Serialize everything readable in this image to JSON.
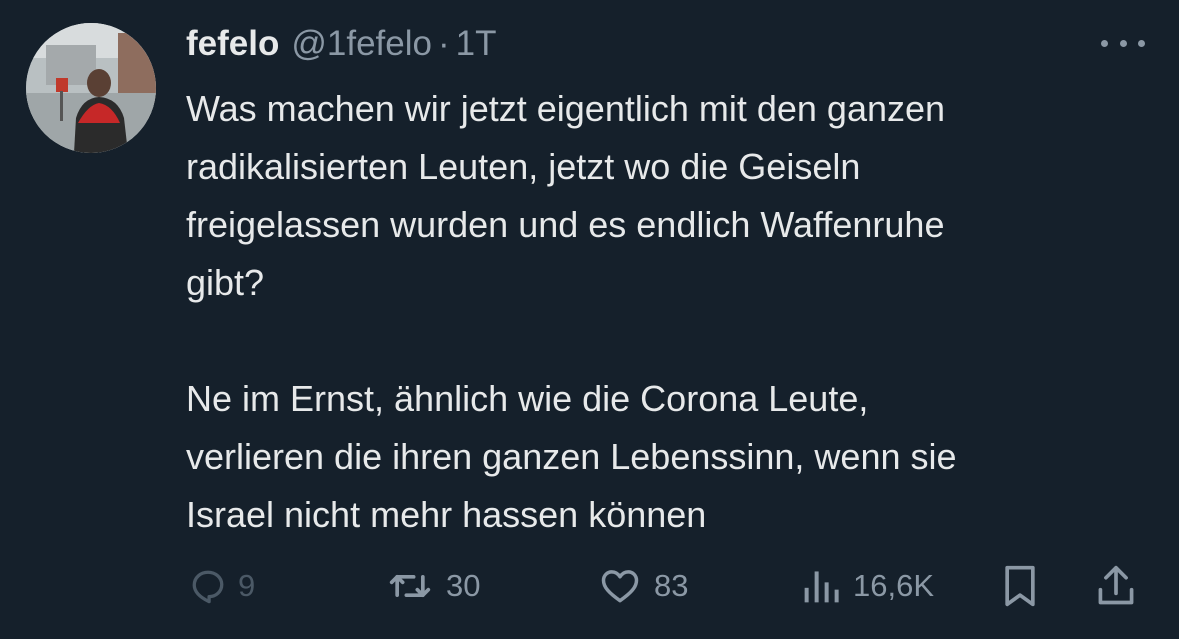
{
  "author": {
    "display_name": "fefelo",
    "handle": "@1fefelo",
    "separator": "·",
    "time": "1T",
    "avatar_icon": "profile-photo"
  },
  "more_menu_icon": "more-dots-icon",
  "tweet": {
    "paragraphs": [
      "Was machen wir jetzt eigentlich mit den ganzen\nradikalisierten Leuten, jetzt wo die Geiseln\nfreigelassen wurden und es endlich Waffenruhe\ngibt?",
      "Ne im Ernst, ähnlich wie die Corona Leute,\nverlieren die ihren ganzen Lebenssinn, wenn sie\nIsrael nicht mehr hassen können"
    ]
  },
  "actions": {
    "reply": {
      "icon": "reply-icon",
      "count": "9"
    },
    "retweet": {
      "icon": "retweet-icon",
      "count": "30"
    },
    "like": {
      "icon": "heart-icon",
      "count": "83"
    },
    "views": {
      "icon": "views-icon",
      "count": "16,6K"
    },
    "bookmark": {
      "icon": "bookmark-icon"
    },
    "share": {
      "icon": "share-icon"
    }
  },
  "colors": {
    "background": "#15202b",
    "primary_text": "#e7e9ea",
    "secondary_text": "#8b98a5"
  }
}
